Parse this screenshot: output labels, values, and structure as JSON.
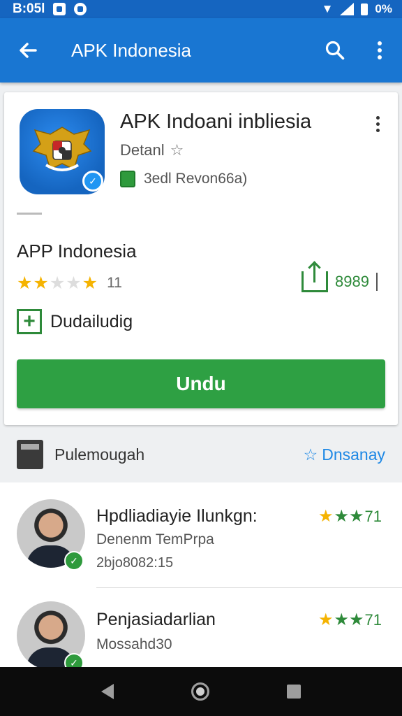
{
  "status_bar": {
    "time": "B:05l",
    "battery_text": "0%"
  },
  "app_bar": {
    "title": "APK Indonesia"
  },
  "app_card": {
    "app_name": "APK Indoani inbliesia",
    "developer": "Detanl",
    "size_text": "3edl Revon66a)",
    "section_title": "APP Indonesia",
    "rating_count": "11",
    "share_count": "8989",
    "checkbox_label": "Dudailudig",
    "install_label": "Undu"
  },
  "reviews_header": {
    "label": "Pulemougah",
    "link": "Dnsanay"
  },
  "reviews": [
    {
      "name": "Hpdliadiayie Ilunkgn:",
      "subtitle": "Denenm TemPrpa",
      "date": "2bjo8082:15",
      "rating": "71"
    },
    {
      "name": "Penjasiadarlian",
      "subtitle": "Mossahd30",
      "date": "",
      "rating": "71"
    }
  ],
  "colors": {
    "primary": "#1976d2",
    "status": "#1565c0",
    "install": "#2ea043",
    "star": "#f5b301",
    "link": "#1e88e5"
  },
  "icons": [
    "arrow-left-icon",
    "search-icon",
    "more-vert-icon",
    "star-outline-icon",
    "share-icon",
    "plus-box-icon",
    "verified-icon",
    "back-nav-icon",
    "home-nav-icon",
    "recents-nav-icon"
  ]
}
